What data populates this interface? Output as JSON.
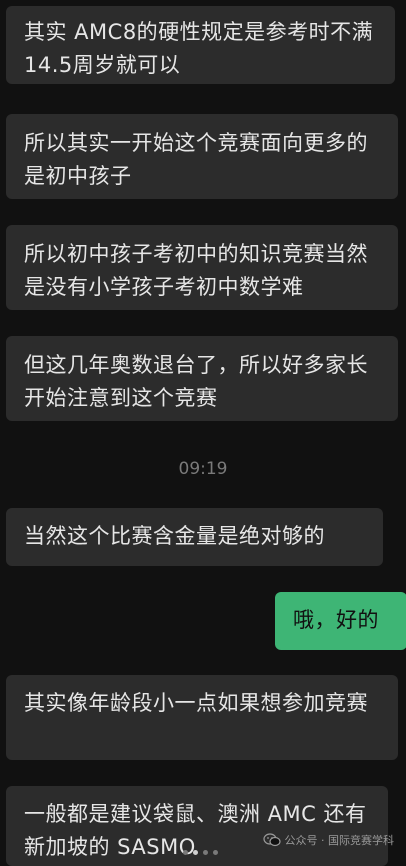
{
  "messages": [
    {
      "type": "incoming",
      "text": "其实 AMC8的硬性规定是参考时不满14.5周岁就可以"
    },
    {
      "type": "incoming",
      "text": "所以其实一开始这个竞赛面向更多的是初中孩子"
    },
    {
      "type": "incoming",
      "text": "所以初中孩子考初中的知识竞赛当然是没有小学孩子考初中数学难"
    },
    {
      "type": "incoming",
      "text": "但这几年奥数退台了，所以好多家长开始注意到这个竞赛"
    },
    {
      "type": "timestamp",
      "text": "09:19"
    },
    {
      "type": "incoming",
      "text": "当然这个比赛含金量是绝对够的"
    },
    {
      "type": "outgoing",
      "text": "哦，好的"
    },
    {
      "type": "incoming",
      "text": "其实像年龄段小一点如果想参加竞赛"
    },
    {
      "type": "incoming",
      "text": "一般都是建议袋鼠、澳洲 AMC 还有新加坡的 SASMO"
    }
  ],
  "watermark": {
    "icon": "wechat-official-account-icon",
    "text": "公众号 · 国际竞赛学科"
  },
  "colors": {
    "background": "#111111",
    "incoming_bubble": "#2c2c2c",
    "outgoing_bubble": "#3eb575",
    "timestamp": "#7a7a7a"
  }
}
